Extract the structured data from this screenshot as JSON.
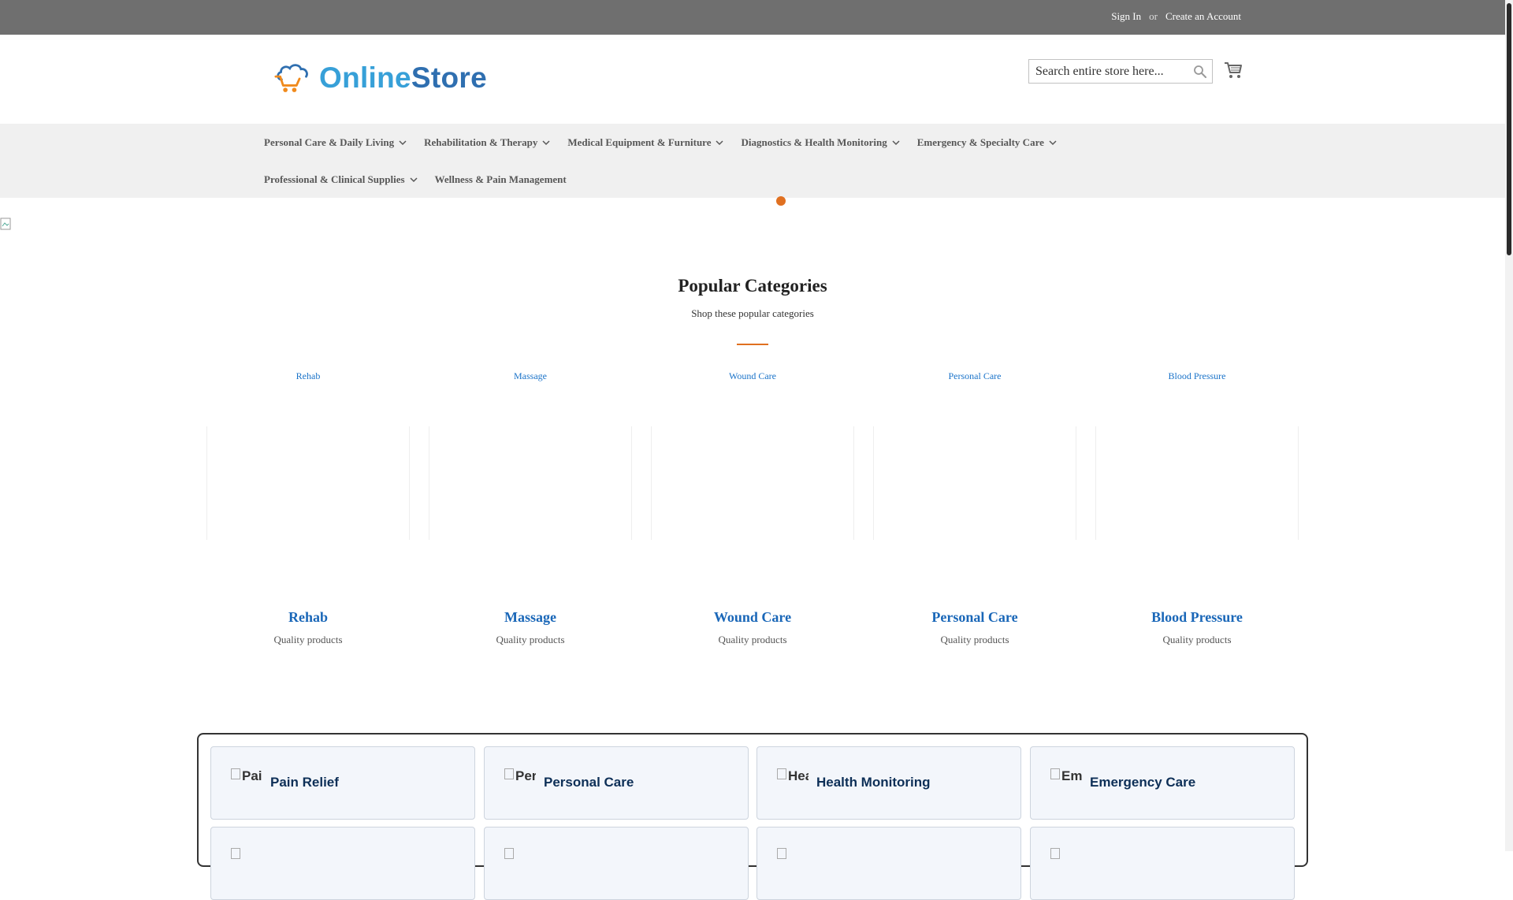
{
  "topbar": {
    "sign_in": "Sign In",
    "or": "or",
    "create_account": "Create an Account"
  },
  "header": {
    "logo_online": "Online",
    "logo_store": "Store",
    "search_placeholder": "Search entire store here..."
  },
  "nav": {
    "row1": [
      {
        "label": "Personal Care & Daily Living",
        "dropdown": true
      },
      {
        "label": "Rehabilitation & Therapy",
        "dropdown": true
      },
      {
        "label": "Medical Equipment & Furniture",
        "dropdown": true
      },
      {
        "label": "Diagnostics & Health Monitoring",
        "dropdown": true
      },
      {
        "label": "Emergency & Specialty Care",
        "dropdown": true
      }
    ],
    "row2": [
      {
        "label": "Professional & Clinical Supplies",
        "dropdown": true
      },
      {
        "label": "Wellness & Pain Management",
        "dropdown": false
      }
    ]
  },
  "popular": {
    "title": "Popular Categories",
    "subtitle": "Shop these popular categories",
    "categories": [
      {
        "alt": "Rehab",
        "name": "Rehab",
        "sub": "Quality products"
      },
      {
        "alt": "Massage",
        "name": "Massage",
        "sub": "Quality products"
      },
      {
        "alt": "Wound Care",
        "name": "Wound Care",
        "sub": "Quality products"
      },
      {
        "alt": "Personal Care",
        "name": "Personal Care",
        "sub": "Quality products"
      },
      {
        "alt": "Blood Pressure",
        "name": "Blood Pressure",
        "sub": "Quality products"
      }
    ]
  },
  "quicklinks": {
    "row1": [
      {
        "icon_alt": "Pain Relief",
        "label": "Pain Relief"
      },
      {
        "icon_alt": "Personal Care",
        "label": "Personal Care"
      },
      {
        "icon_alt": "Health Monitoring",
        "label": "Health Monitoring"
      },
      {
        "icon_alt": "Emergency Care",
        "label": "Emergency Care"
      }
    ]
  },
  "colors": {
    "accent": "#e07020",
    "link": "#1a67b8",
    "topbar": "#6f6f6f",
    "nav_bg": "#f0f0f0"
  }
}
